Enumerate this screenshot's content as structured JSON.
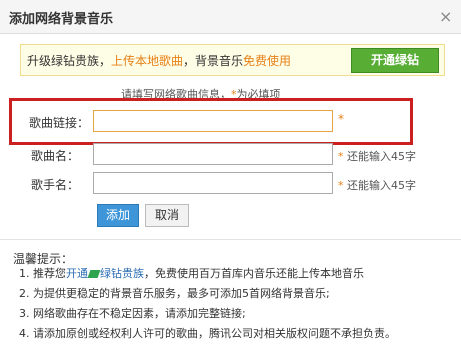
{
  "dialog": {
    "title": "添加网络背景音乐",
    "close_label": "×"
  },
  "banner": {
    "text_prefix": "升级绿钻贵族，",
    "text_upload": "上传本地歌曲",
    "text_mid": "，背景音乐",
    "text_free": "免费使用",
    "button_label": "开通绿钻"
  },
  "hint": {
    "text": "请填写网络歌曲信息，",
    "star": "*",
    "suffix": "为必填项"
  },
  "form": {
    "link_label": "歌曲链接：",
    "link_value": "",
    "link_required": "*",
    "name_label": "歌曲名：",
    "name_value": "",
    "name_note_star": "*",
    "name_note": "还能输入45字",
    "singer_label": "歌手名：",
    "singer_value": "",
    "singer_note_star": "*",
    "singer_note": "还能输入45字"
  },
  "buttons": {
    "add": "添加",
    "cancel": "取消"
  },
  "tips": {
    "title": "温馨提示：",
    "line1_prefix": "1. 推荐您",
    "line1_link": "开通",
    "line1_link2": "绿钻贵族",
    "line1_suffix": "，免费使用百万首库内音乐还能上传本地音乐",
    "line2": "2. 为提供更稳定的背景音乐服务，最多可添加5首网络背景音乐;",
    "line3": "3. 网络歌曲存在不稳定因素，请添加完整链接;",
    "line4": "4. 请添加原创或经权利人许可的歌曲，腾讯公司对相关版权问题不承担负责。"
  },
  "colors": {
    "accent_orange": "#e68117",
    "green_button": "#58ae35",
    "blue_button": "#3e96d8",
    "highlight_red": "#cc1f1f"
  }
}
